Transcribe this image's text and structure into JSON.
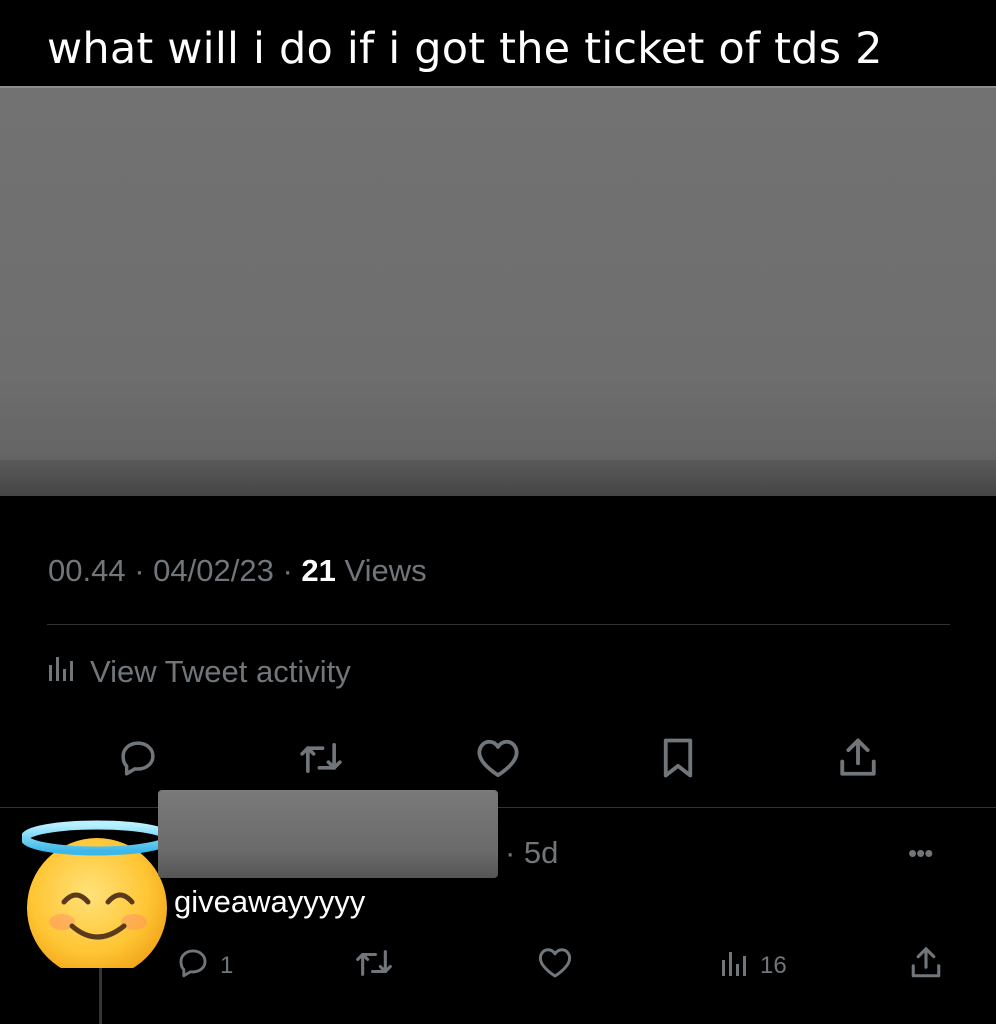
{
  "caption": "what will i do if i got the ticket of tds 2",
  "tweet": {
    "time": "00.44",
    "date": "04/02/23",
    "views_count": "21",
    "views_label": "Views",
    "separator": "·",
    "activity_label": "View Tweet activity"
  },
  "actions": [
    {
      "icon": "reply-icon"
    },
    {
      "icon": "retweet-icon"
    },
    {
      "icon": "like-icon"
    },
    {
      "icon": "bookmark-icon"
    },
    {
      "icon": "share-icon"
    }
  ],
  "reply": {
    "avatar": "smiling-face-with-halo-emoji",
    "time": "· 5d",
    "more": "•••",
    "text": "giveawayyyyy",
    "reply_count": "1",
    "views_count": "16"
  },
  "colors": {
    "background": "#000000",
    "muted": "#71767b",
    "text": "#ffffff",
    "divider": "#2f3336"
  }
}
